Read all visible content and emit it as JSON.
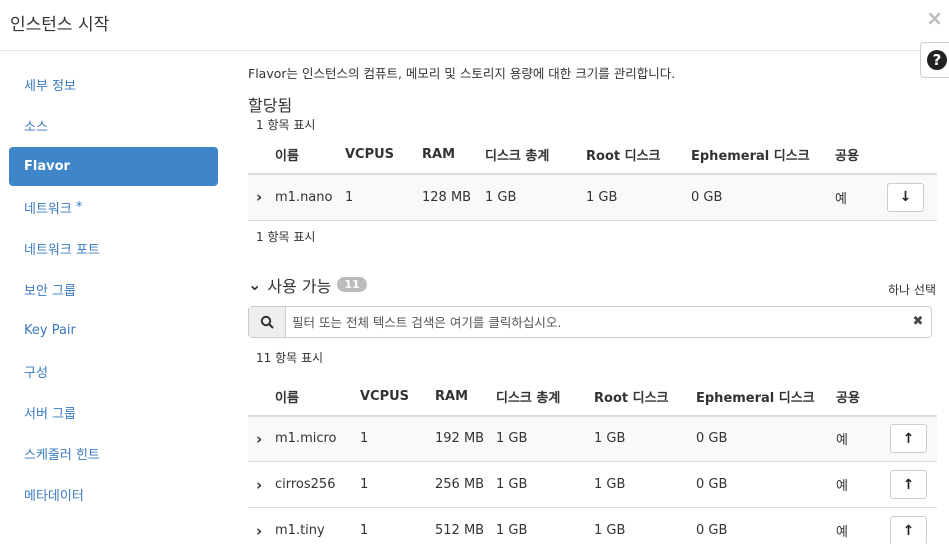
{
  "modal": {
    "title": "인스턴스 시작",
    "close_icon": "×",
    "help_icon": "?"
  },
  "sidebar": {
    "items": [
      {
        "label": "세부 정보"
      },
      {
        "label": "소스"
      },
      {
        "label": "Flavor"
      },
      {
        "label": "네트워크",
        "required": "*"
      },
      {
        "label": "네트워크 포트"
      },
      {
        "label": "보안 그룹"
      },
      {
        "label": "Key Pair"
      },
      {
        "label": "구성"
      },
      {
        "label": "서버 그룹"
      },
      {
        "label": "스케줄러 힌트"
      },
      {
        "label": "메타데이터"
      }
    ]
  },
  "main": {
    "description": "Flavor는 인스턴스의 컴퓨트, 메모리 및 스토리지 용량에 대한 크기를 관리합니다.",
    "allocated": {
      "title": "할당됨",
      "count_top": "1 항목 표시",
      "count_bottom": "1 항목 표시",
      "columns": [
        "이름",
        "VCPUS",
        "RAM",
        "디스크 총계",
        "Root 디스크",
        "Ephemeral 디스크",
        "공용"
      ],
      "rows": [
        {
          "name": "m1.nano",
          "vcpus": "1",
          "ram": "128 MB",
          "disk": "1 GB",
          "root": "1 GB",
          "ephemeral": "0 GB",
          "public": "예"
        }
      ]
    },
    "available": {
      "title": "사용 가능",
      "badge": "11",
      "select_one": "하나 선택",
      "filter_placeholder": "필터 또는 전체 텍스트 검색은 여기를 클릭하십시오.",
      "count": "11 항목 표시",
      "columns": [
        "이름",
        "VCPUS",
        "RAM",
        "디스크 총계",
        "Root 디스크",
        "Ephemeral 디스크",
        "공용"
      ],
      "rows": [
        {
          "name": "m1.micro",
          "vcpus": "1",
          "ram": "192 MB",
          "disk": "1 GB",
          "root": "1 GB",
          "ephemeral": "0 GB",
          "public": "예"
        },
        {
          "name": "cirros256",
          "vcpus": "1",
          "ram": "256 MB",
          "disk": "1 GB",
          "root": "1 GB",
          "ephemeral": "0 GB",
          "public": "예"
        },
        {
          "name": "m1.tiny",
          "vcpus": "1",
          "ram": "512 MB",
          "disk": "1 GB",
          "root": "1 GB",
          "ephemeral": "0 GB",
          "public": "예"
        }
      ]
    }
  },
  "colors": {
    "accent": "#3f86c9",
    "link": "#3a7ac0",
    "badge": "#bbbbbb"
  }
}
